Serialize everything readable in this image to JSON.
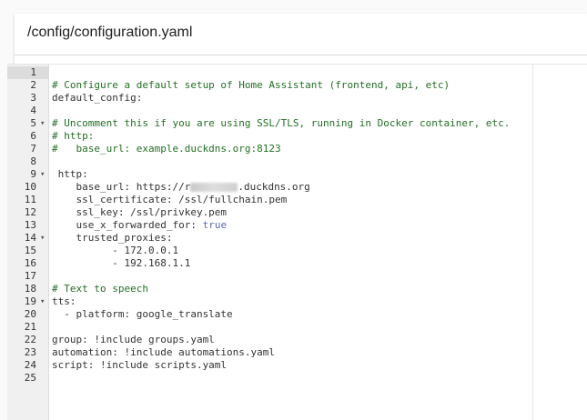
{
  "header": {
    "title": "/config/configuration.yaml"
  },
  "editor": {
    "lines": [
      {
        "n": "1",
        "fold": "",
        "parts": [
          {
            "t": "",
            "c": "ws"
          }
        ]
      },
      {
        "n": "2",
        "fold": "",
        "parts": [
          {
            "t": "# Configure a default setup of Home Assistant (frontend, api, etc)",
            "c": "comment"
          }
        ]
      },
      {
        "n": "3",
        "fold": "",
        "parts": [
          {
            "t": "default_config:",
            "c": "key"
          }
        ]
      },
      {
        "n": "4",
        "fold": "",
        "parts": [
          {
            "t": "",
            "c": "ws"
          }
        ]
      },
      {
        "n": "5",
        "fold": "▾",
        "parts": [
          {
            "t": "# Uncomment this if you are using SSL/TLS, running in Docker container, etc.",
            "c": "comment"
          }
        ]
      },
      {
        "n": "6",
        "fold": "",
        "parts": [
          {
            "t": "# http:",
            "c": "comment"
          }
        ]
      },
      {
        "n": "7",
        "fold": "",
        "parts": [
          {
            "t": "#   base_url: example.duckdns.org:8123",
            "c": "comment"
          }
        ]
      },
      {
        "n": "8",
        "fold": "",
        "parts": [
          {
            "t": "",
            "c": "ws"
          }
        ]
      },
      {
        "n": "9",
        "fold": "▾",
        "parts": [
          {
            "t": " http:",
            "c": "key"
          }
        ]
      },
      {
        "n": "10",
        "fold": "",
        "parts": [
          {
            "t": "    base_url: https://r",
            "c": "key"
          },
          {
            "t": "",
            "c": "blur"
          },
          {
            "t": ".duckdns.org",
            "c": "key"
          }
        ]
      },
      {
        "n": "11",
        "fold": "",
        "parts": [
          {
            "t": "    ssl_certificate: /ssl/fullchain.pem",
            "c": "key"
          }
        ]
      },
      {
        "n": "12",
        "fold": "",
        "parts": [
          {
            "t": "    ssl_key: /ssl/privkey.pem",
            "c": "key"
          }
        ]
      },
      {
        "n": "13",
        "fold": "",
        "parts": [
          {
            "t": "    use_x_forwarded_for: ",
            "c": "key"
          },
          {
            "t": "true",
            "c": "bool"
          }
        ]
      },
      {
        "n": "14",
        "fold": "▾",
        "parts": [
          {
            "t": "    trusted_proxies:",
            "c": "key"
          }
        ]
      },
      {
        "n": "15",
        "fold": "",
        "parts": [
          {
            "t": "          - 172.0.0.1",
            "c": "key"
          }
        ]
      },
      {
        "n": "16",
        "fold": "",
        "parts": [
          {
            "t": "          - 192.168.1.1",
            "c": "key"
          }
        ]
      },
      {
        "n": "17",
        "fold": "",
        "parts": [
          {
            "t": "",
            "c": "ws"
          }
        ]
      },
      {
        "n": "18",
        "fold": "",
        "parts": [
          {
            "t": "# Text to speech",
            "c": "comment"
          }
        ]
      },
      {
        "n": "19",
        "fold": "▾",
        "parts": [
          {
            "t": "tts:",
            "c": "key"
          }
        ]
      },
      {
        "n": "20",
        "fold": "",
        "parts": [
          {
            "t": "  - platform: google_translate",
            "c": "key"
          }
        ]
      },
      {
        "n": "21",
        "fold": "",
        "parts": [
          {
            "t": "",
            "c": "ws"
          }
        ]
      },
      {
        "n": "22",
        "fold": "",
        "parts": [
          {
            "t": "group: !include groups.yaml",
            "c": "key"
          }
        ]
      },
      {
        "n": "23",
        "fold": "",
        "parts": [
          {
            "t": "automation: !include automations.yaml",
            "c": "key"
          }
        ]
      },
      {
        "n": "24",
        "fold": "",
        "parts": [
          {
            "t": "script: !include scripts.yaml",
            "c": "key"
          }
        ]
      },
      {
        "n": "25",
        "fold": "",
        "parts": [
          {
            "t": "",
            "c": "ws"
          }
        ]
      }
    ]
  }
}
